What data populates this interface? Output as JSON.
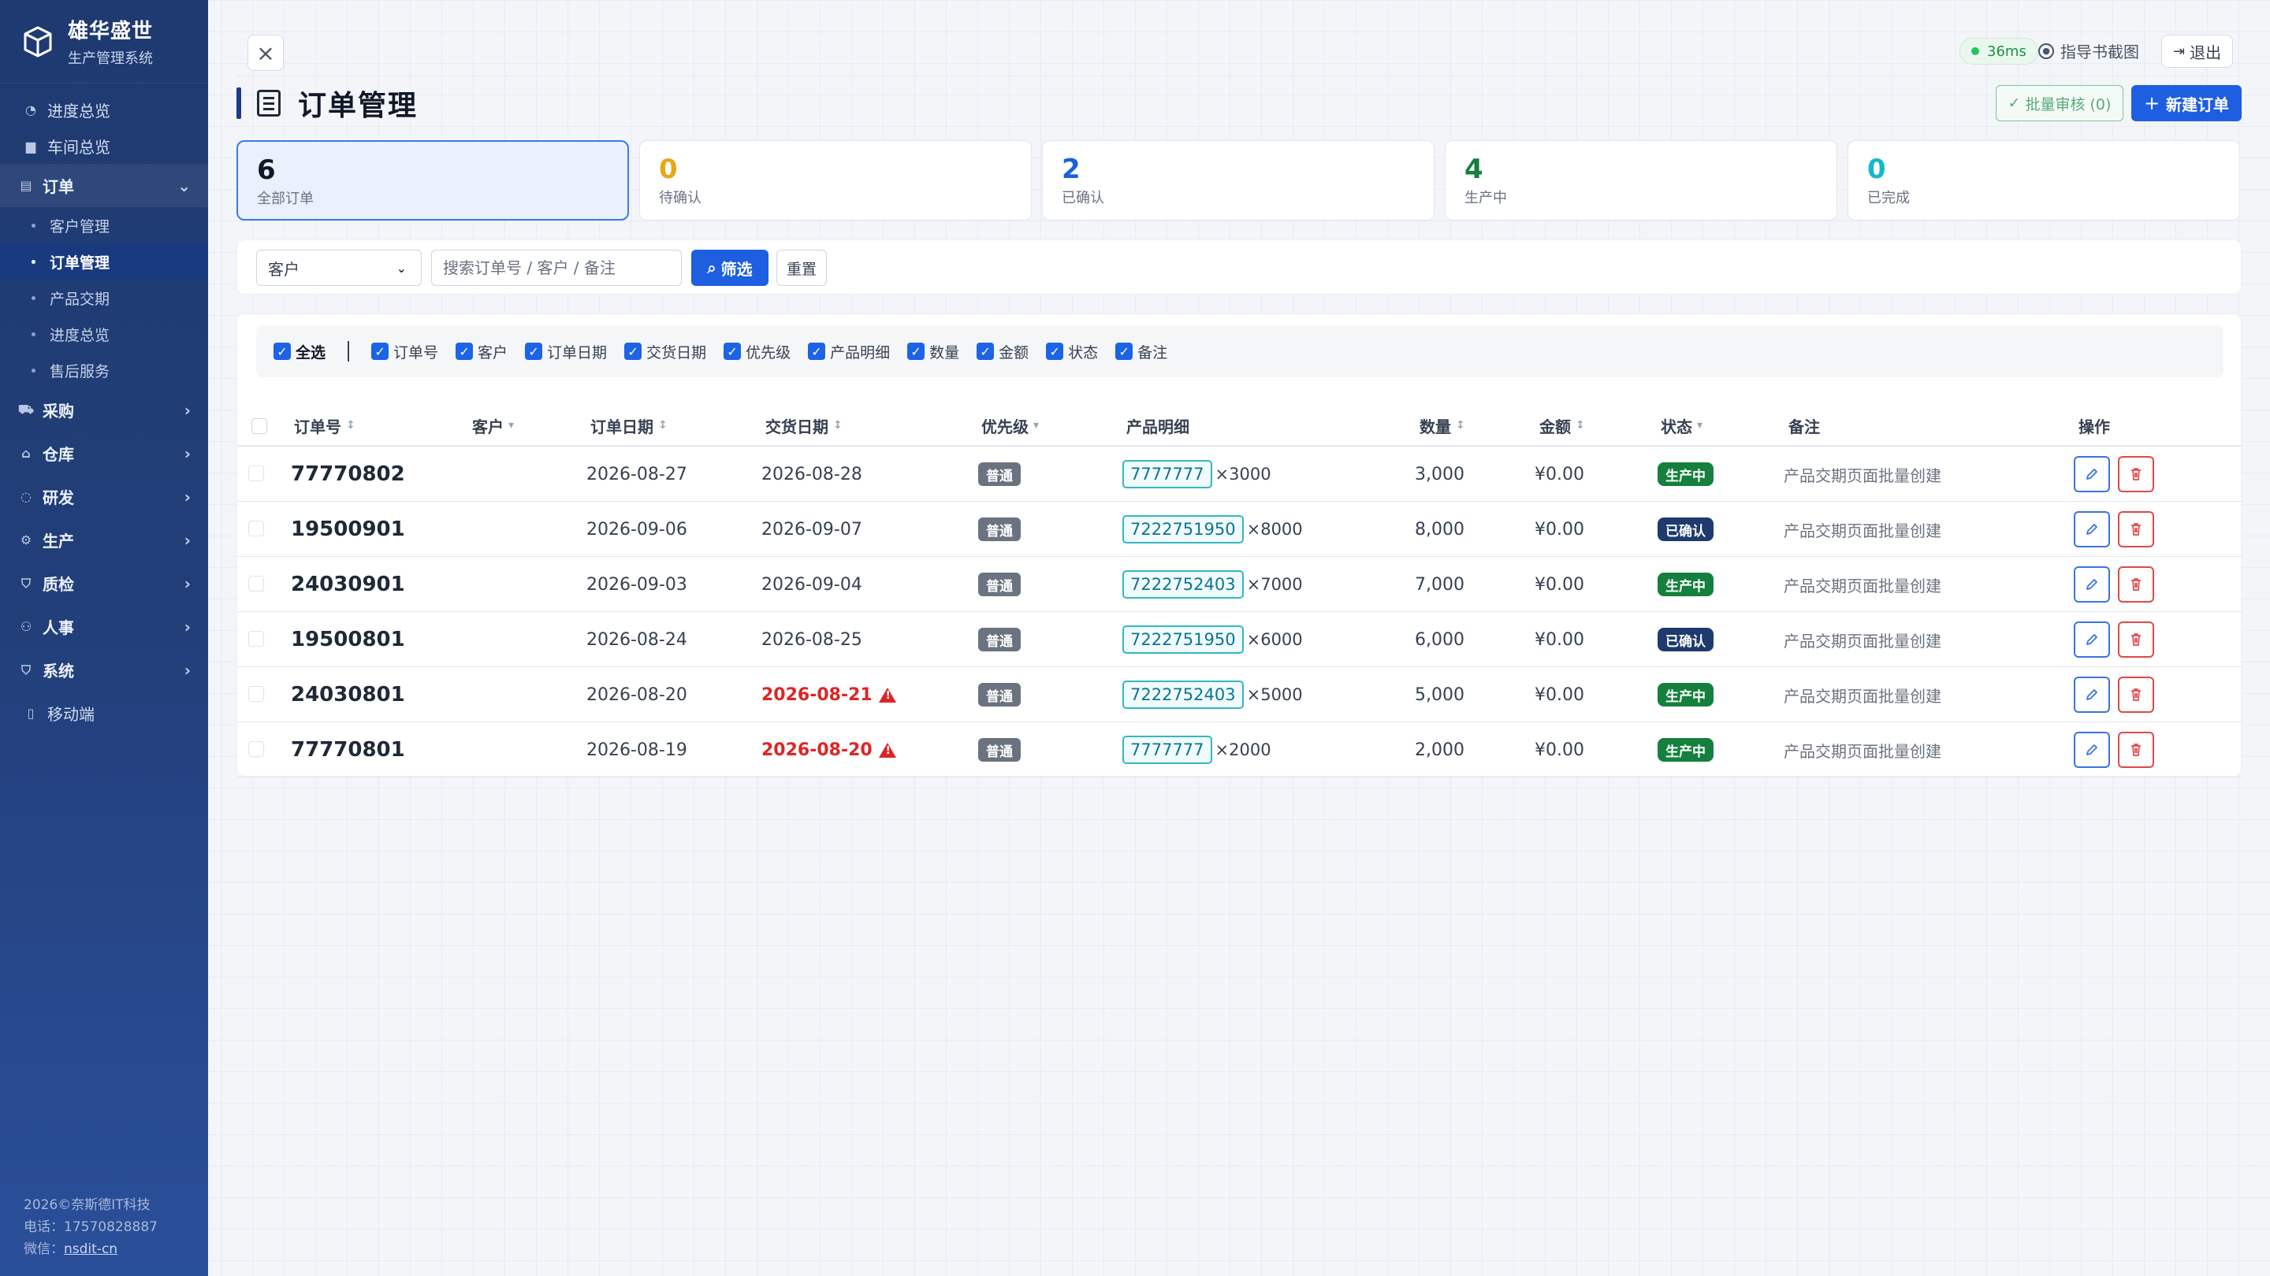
{
  "brand": {
    "title": "雄华盛世",
    "subtitle": "生产管理系统"
  },
  "sidebar": {
    "top_items": [
      {
        "label": "进度总览",
        "icon": "gauge-icon"
      },
      {
        "label": "车间总览",
        "icon": "document-icon"
      }
    ],
    "order_group": {
      "label": "订单",
      "icon": "list-icon"
    },
    "order_sub": [
      {
        "label": "客户管理"
      },
      {
        "label": "订单管理"
      },
      {
        "label": "产品交期"
      },
      {
        "label": "进度总览"
      },
      {
        "label": "售后服务"
      }
    ],
    "groups": [
      {
        "label": "采购",
        "icon": "cart-icon"
      },
      {
        "label": "仓库",
        "icon": "warehouse-icon"
      },
      {
        "label": "研发",
        "icon": "bulb-icon"
      },
      {
        "label": "生产",
        "icon": "gear-icon"
      },
      {
        "label": "质检",
        "icon": "shield-icon"
      },
      {
        "label": "人事",
        "icon": "people-icon"
      },
      {
        "label": "系统",
        "icon": "shield-icon"
      }
    ],
    "mobile": {
      "label": "移动端",
      "icon": "phone-icon"
    },
    "footer": {
      "copyright": "2026©奈斯德IT科技",
      "phone": "电话：17570828887",
      "wechat_label": "微信：",
      "wechat": "nsdit-cn"
    }
  },
  "topbar": {
    "latency": "36ms",
    "guide": "指导书截图",
    "logout": "退出"
  },
  "page": {
    "title": "订单管理",
    "batch_label": "批量审核 (0)",
    "new_label": "新建订单"
  },
  "stats": [
    {
      "num": "6",
      "label": "全部订单",
      "color": "#111827"
    },
    {
      "num": "0",
      "label": "待确认",
      "color": "#e6a817"
    },
    {
      "num": "2",
      "label": "已确认",
      "color": "#1d5fe0"
    },
    {
      "num": "4",
      "label": "生产中",
      "color": "#15803d"
    },
    {
      "num": "0",
      "label": "已完成",
      "color": "#14b8c8"
    }
  ],
  "filter": {
    "select_value": "客户",
    "search_placeholder": "搜索订单号 / 客户 / 备注",
    "filter_label": "筛选",
    "reset_label": "重置"
  },
  "columns_toggle": {
    "all": "全选",
    "items": [
      "订单号",
      "客户",
      "订单日期",
      "交货日期",
      "优先级",
      "产品明细",
      "数量",
      "金额",
      "状态",
      "备注"
    ]
  },
  "table": {
    "headers": {
      "order_no": "订单号",
      "customer": "客户",
      "order_date": "订单日期",
      "delivery_date": "交货日期",
      "priority": "优先级",
      "product": "产品明细",
      "qty": "数量",
      "amount": "金额",
      "status": "状态",
      "remark": "备注",
      "ops": "操作"
    },
    "rows": [
      {
        "order_no": "77770802",
        "customer": "",
        "order_date": "2026-08-27",
        "delivery_date": "2026-08-28",
        "late": false,
        "priority": "普通",
        "code": "7777777",
        "mult": "×3000",
        "qty": "3,000",
        "amount": "¥0.00",
        "status": "生产中",
        "status_color": "#15803d",
        "remark": "产品交期页面批量创建"
      },
      {
        "order_no": "19500901",
        "customer": "",
        "order_date": "2026-09-06",
        "delivery_date": "2026-09-07",
        "late": false,
        "priority": "普通",
        "code": "7222751950",
        "mult": "×8000",
        "qty": "8,000",
        "amount": "¥0.00",
        "status": "已确认",
        "status_color": "#1e3a6e",
        "remark": "产品交期页面批量创建"
      },
      {
        "order_no": "24030901",
        "customer": "",
        "order_date": "2026-09-03",
        "delivery_date": "2026-09-04",
        "late": false,
        "priority": "普通",
        "code": "7222752403",
        "mult": "×7000",
        "qty": "7,000",
        "amount": "¥0.00",
        "status": "生产中",
        "status_color": "#15803d",
        "remark": "产品交期页面批量创建"
      },
      {
        "order_no": "19500801",
        "customer": "",
        "order_date": "2026-08-24",
        "delivery_date": "2026-08-25",
        "late": false,
        "priority": "普通",
        "code": "7222751950",
        "mult": "×6000",
        "qty": "6,000",
        "amount": "¥0.00",
        "status": "已确认",
        "status_color": "#1e3a6e",
        "remark": "产品交期页面批量创建"
      },
      {
        "order_no": "24030801",
        "customer": "",
        "order_date": "2026-08-20",
        "delivery_date": "2026-08-21",
        "late": true,
        "priority": "普通",
        "code": "7222752403",
        "mult": "×5000",
        "qty": "5,000",
        "amount": "¥0.00",
        "status": "生产中",
        "status_color": "#15803d",
        "remark": "产品交期页面批量创建"
      },
      {
        "order_no": "77770801",
        "customer": "",
        "order_date": "2026-08-19",
        "delivery_date": "2026-08-20",
        "late": true,
        "priority": "普通",
        "code": "7777777",
        "mult": "×2000",
        "qty": "2,000",
        "amount": "¥0.00",
        "status": "生产中",
        "status_color": "#15803d",
        "remark": "产品交期页面批量创建"
      }
    ]
  }
}
